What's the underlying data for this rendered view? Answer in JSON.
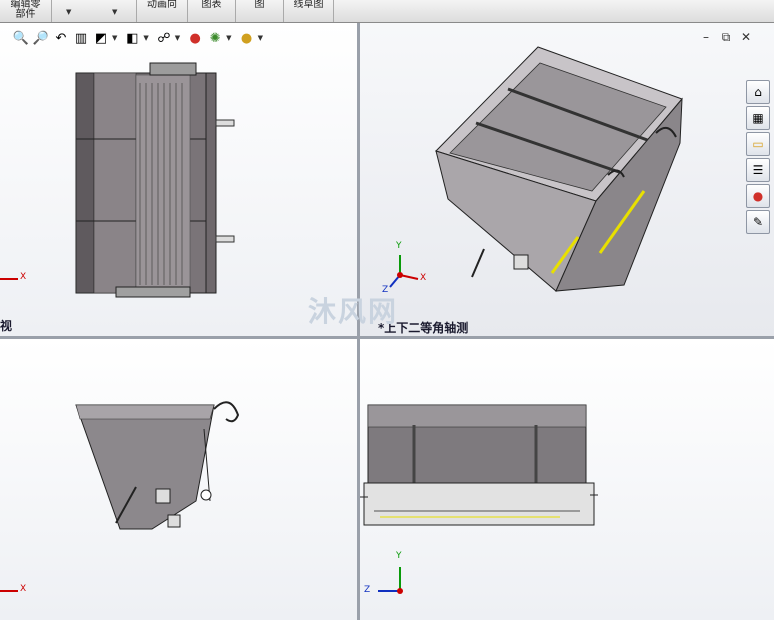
{
  "toolbar": {
    "items": [
      {
        "label": "编辑零\n部件"
      },
      {
        "label": "动画向"
      },
      {
        "label": "图表"
      },
      {
        "label": "图"
      },
      {
        "label": "线草图"
      }
    ]
  },
  "view_toolbar": {
    "icons": [
      "zoom-to-fit-icon",
      "zoom-area-icon",
      "previous-view-icon",
      "section-view-icon",
      "view-orientation-icon",
      "display-style-icon",
      "hide-show-icon",
      "edit-appearance-icon",
      "apply-scene-icon",
      "view-settings-icon"
    ]
  },
  "panes": {
    "top_left": {
      "label": "视"
    },
    "top_right": {
      "label": "*上下二等角轴测"
    },
    "bottom_left": {
      "label": ""
    },
    "bottom_right": {
      "label": ""
    }
  },
  "axes": {
    "x": "X",
    "y": "Y",
    "z": "Z"
  },
  "watermark": {
    "text": "沐风网"
  },
  "window_controls": {
    "minimize": "–",
    "restore": "⧉",
    "close": "✕"
  },
  "task_pane": {
    "icons": [
      "home-icon",
      "design-library-icon",
      "file-explorer-icon",
      "view-palette-icon",
      "appearances-icon",
      "custom-properties-icon"
    ]
  },
  "colors": {
    "accent_yellow": "#e8e000",
    "axis_red": "#cc0000",
    "axis_green": "#0a9a0a",
    "axis_blue": "#1030c0"
  }
}
